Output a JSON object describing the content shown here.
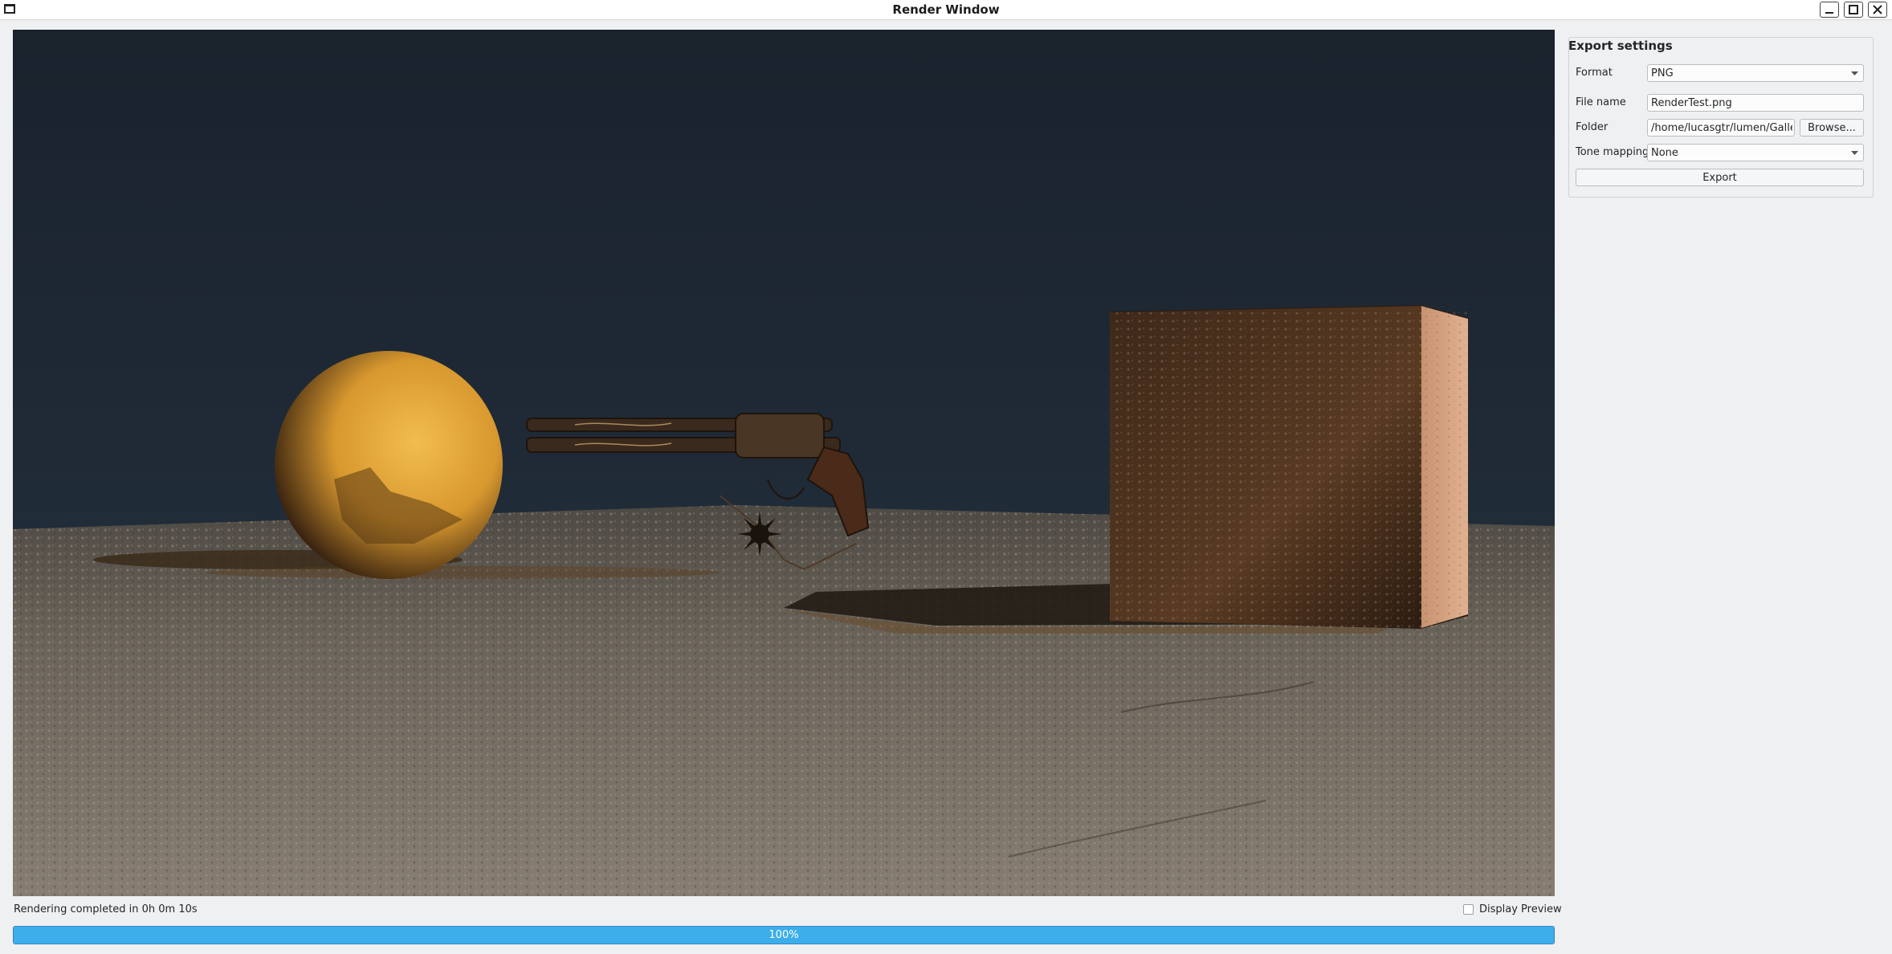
{
  "window": {
    "title": "Render Window"
  },
  "status": {
    "message": "Rendering completed in 0h 0m 10s",
    "display_preview_label": "Display Preview",
    "display_preview_checked": false,
    "progress_percent": 100,
    "progress_label": "100%"
  },
  "export_settings": {
    "title": "Export settings",
    "format_label": "Format",
    "format_value": "PNG",
    "file_name_label": "File name",
    "file_name_value": "RenderTest.png",
    "folder_label": "Folder",
    "folder_value": "/home/lucasgtr/lumen/Gallery",
    "browse_label": "Browse...",
    "tone_mapping_label": "Tone mapping",
    "tone_mapping_value": "None",
    "export_label": "Export"
  },
  "colors": {
    "accent": "#3daee9",
    "sky": "#1c2530",
    "ground": "#6e665c",
    "sphere": "#e3a63c",
    "cube": "#5a3c28"
  },
  "icons": {
    "app": "window-icon",
    "minimize": "minimize-icon",
    "maximize": "maximize-icon",
    "close": "close-icon",
    "dropdown": "chevron-down-icon"
  }
}
